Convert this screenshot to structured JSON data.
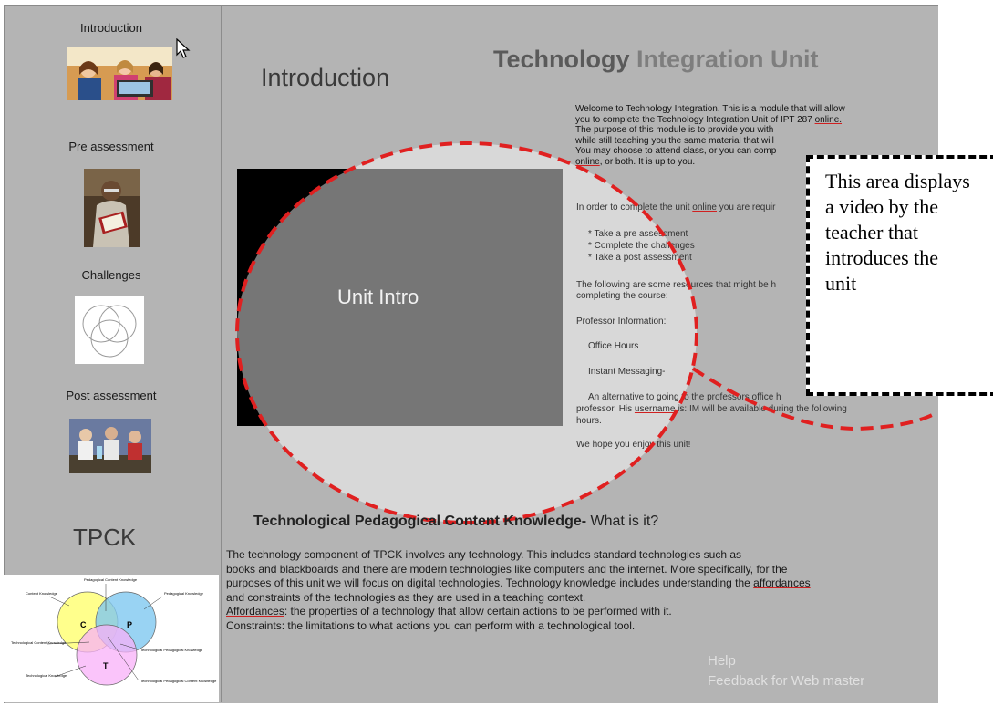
{
  "nav": {
    "items": [
      {
        "label": "Introduction"
      },
      {
        "label": "Pre assessment"
      },
      {
        "label": "Challenges"
      },
      {
        "label": "Post assessment"
      }
    ]
  },
  "header": {
    "page_heading": "Introduction",
    "title_part1": "Technology",
    "title_part2": "Integration Unit"
  },
  "welcome": {
    "line1": "Welcome to Technology Integration. This is a module that will allow",
    "line2_a": "you to complete the Technology Integration Unit of IPT 287 ",
    "line2_link": "online.",
    "line3": "The purpose of this module is to provide you with",
    "line4": "while still teaching you the same material that will",
    "line5": "You may choose to attend class, or you can comp",
    "line6_a": "online",
    "line6_b": ", or both. It is up to you."
  },
  "requirements": {
    "intro_a": "In order to complete the unit ",
    "intro_link": "online",
    "intro_b": " you are requir",
    "items": [
      "* Take a pre assessment",
      "* Complete the challenges",
      "* Take a post assessment"
    ]
  },
  "resources": {
    "line1": "The following are some resources that might be h",
    "line2": "completing the course:",
    "professor_heading": "Professor Information:",
    "office_hours": "Office Hours",
    "instant_messaging": "Instant Messaging-",
    "alt_line1": "An alternative to going to the professors office h",
    "alt_line2_a": "professor. His ",
    "alt_line2_link": "username",
    "alt_line2_b": " is: IM will be available during the following",
    "alt_line3": "hours.",
    "closing": "We hope you enjoy this unit!"
  },
  "video": {
    "label": "Unit Intro"
  },
  "callout": {
    "text": "This area displays a video by the teacher that introduces the unit"
  },
  "tpck": {
    "side_title": "TPCK",
    "heading_bold": "Technological Pedagogical Content Knowledge-",
    "heading_rest": " What is it?",
    "para1_line1": "The technology component of TPCK involves any technology.  This includes standard technologies such as",
    "para1_line2": "books and blackboards and there are modern technologies like computers and the internet.  More specifically, for the",
    "para1_line3_a": "purposes of this unit we will focus on digital technologies. Technology knowledge includes understanding the ",
    "para1_line3_link": "affordances",
    "para1_line4": "and constraints of the technologies as they are used in a teaching context.",
    "affordances_term": "Affordances",
    "affordances_def": ": the properties of a technology that allow certain actions to be performed with it.",
    "constraints_line": "Constraints: the limitations to what actions you can perform with a technological tool.",
    "diagram": {
      "c_label": "C",
      "p_label": "P",
      "t_label": "T",
      "content_knowledge": "Content Knowledge",
      "pedagogical_knowledge": "Pedagogical Knowledge",
      "technological_knowledge": "Technological Knowledge",
      "pck": "Pedagogical Content Knowledge",
      "tck": "Technological Content Knowledge",
      "tpk": "Technological Pedagogical Knowledge",
      "tpck": "Technological Pedagogical Content Knowledge"
    }
  },
  "footer": {
    "help": "Help",
    "feedback": "Feedback for Web master"
  },
  "colors": {
    "panel_bg": "#b4b4b4",
    "dashed_red": "#e02020",
    "venn_c": "#ffff80",
    "venn_p": "#80c8f0",
    "venn_t": "#f8b0f8"
  }
}
